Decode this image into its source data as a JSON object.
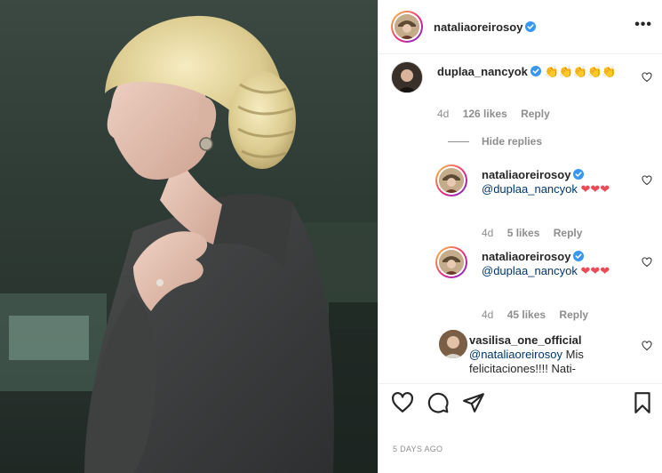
{
  "post": {
    "owner_username": "nataliaoreirosoy",
    "more_label": "•••",
    "timestamp": "5 DAYS AGO"
  },
  "comments": [
    {
      "username": "duplaa_nancyok",
      "text": "👏👏👏👏👏",
      "age": "4d",
      "likes": "126 likes",
      "reply_label": "Reply"
    },
    {
      "username": "nataliaoreirosoy",
      "mention": "@duplaa_nancyok",
      "text": "❤❤❤",
      "age": "4d",
      "likes": "5 likes",
      "reply_label": "Reply"
    },
    {
      "username": "nataliaoreirosoy",
      "mention": "@duplaa_nancyok",
      "text": "❤❤❤",
      "age": "4d",
      "likes": "45 likes",
      "reply_label": "Reply"
    },
    {
      "username": "vasilisa_one_official",
      "mention": "@nataliaoreirosoy",
      "text": "Mis felicitaciones!!!! Nati-"
    }
  ],
  "hide_replies_label": "Hide replies",
  "icons": {
    "like": "heart-icon",
    "comment": "comment-icon",
    "share": "send-icon",
    "save": "bookmark-icon",
    "verified": "verified-badge-icon"
  },
  "colors": {
    "verified": "#3897f0",
    "heart": "#ed4956",
    "mention": "#00376b",
    "muted": "#8e8e8e"
  }
}
